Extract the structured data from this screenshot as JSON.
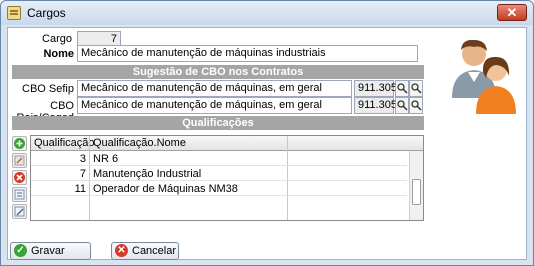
{
  "window": {
    "title": "Cargos",
    "close_glyph": "✕"
  },
  "form": {
    "cargo_label": "Cargo",
    "cargo_value": "7",
    "nome_label": "Nome",
    "nome_value": "Mecânico de manutenção de máquinas industriais"
  },
  "cbo": {
    "section_title": "Sugestão de CBO nos Contratos",
    "sefip_label": "CBO Sefip",
    "sefip_desc": "Mecânico de manutenção de máquinas, em geral",
    "sefip_code": "911.305",
    "rais_label": "CBO Rais/Caged",
    "rais_desc": "Mecânico de manutenção de máquinas, em geral",
    "rais_code": "911.305"
  },
  "qualificacoes": {
    "section_title": "Qualificações",
    "columns": [
      "Qualificação",
      "Qualificação.Nome"
    ],
    "rows": [
      {
        "id": "3",
        "nome": "NR 6"
      },
      {
        "id": "7",
        "nome": "Manutenção Industrial"
      },
      {
        "id": "11",
        "nome": "Operador de Máquinas NM38"
      }
    ]
  },
  "buttons": {
    "save_label": "Gravar",
    "cancel_label": "Cancelar"
  },
  "icons": {
    "add": "add-icon",
    "edit": "edit-icon",
    "delete": "delete-icon",
    "list": "list-icon",
    "edit2": "edit-record-icon",
    "search": "search-icon",
    "users": "users-avatar-icon"
  },
  "colors": {
    "section_bg": "#a5a5a5",
    "window_bg": "#d9e4f1",
    "close_red": "#c23a22",
    "add_green": "#3aa335",
    "delete_red": "#d23a2a"
  }
}
